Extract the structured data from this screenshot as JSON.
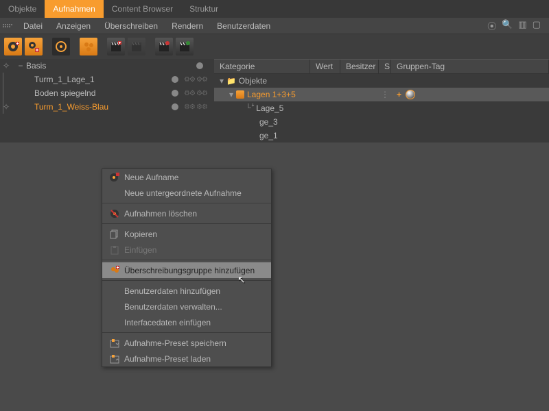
{
  "tabs": {
    "objekte": "Objekte",
    "aufnahmen": "Aufnahmen",
    "content": "Content Browser",
    "struktur": "Struktur"
  },
  "menubar": {
    "datei": "Datei",
    "anzeigen": "Anzeigen",
    "ueberschreiben": "Überschreiben",
    "rendern": "Rendern",
    "benutzerdaten": "Benutzerdaten"
  },
  "left_tree": {
    "basis": "Basis",
    "children": [
      {
        "label": "Turm_1_Lage_1"
      },
      {
        "label": "Boden spiegelnd"
      },
      {
        "label": "Turm_1_Weiss-Blau",
        "selected": true
      }
    ]
  },
  "headers": {
    "kategorie": "Kategorie",
    "wert": "Wert",
    "besitzer": "Besitzer",
    "s": "S",
    "gruppen_tag": "Gruppen-Tag"
  },
  "right_tree": {
    "objekte": "Objekte",
    "lagen": "Lagen 1+3+5",
    "lage5": "Lage_5",
    "lage3_frag": "ge_3",
    "lage1_frag": "ge_1"
  },
  "context_menu": {
    "neue_aufnahme": "Neue Aufname",
    "neue_unter": "Neue untergeordnete Aufnahme",
    "loeschen": "Aufnahmen löschen",
    "kopieren": "Kopieren",
    "einfuegen": "Einfügen",
    "gruppe": "Überschreibungsgruppe hinzufügen",
    "bd_hinzu": "Benutzerdaten hinzufügen",
    "bd_verwalten": "Benutzerdaten verwalten...",
    "ifdaten": "Interfacedaten einfügen",
    "preset_speichern": "Aufnahme-Preset speichern",
    "preset_laden": "Aufnahme-Preset laden"
  }
}
